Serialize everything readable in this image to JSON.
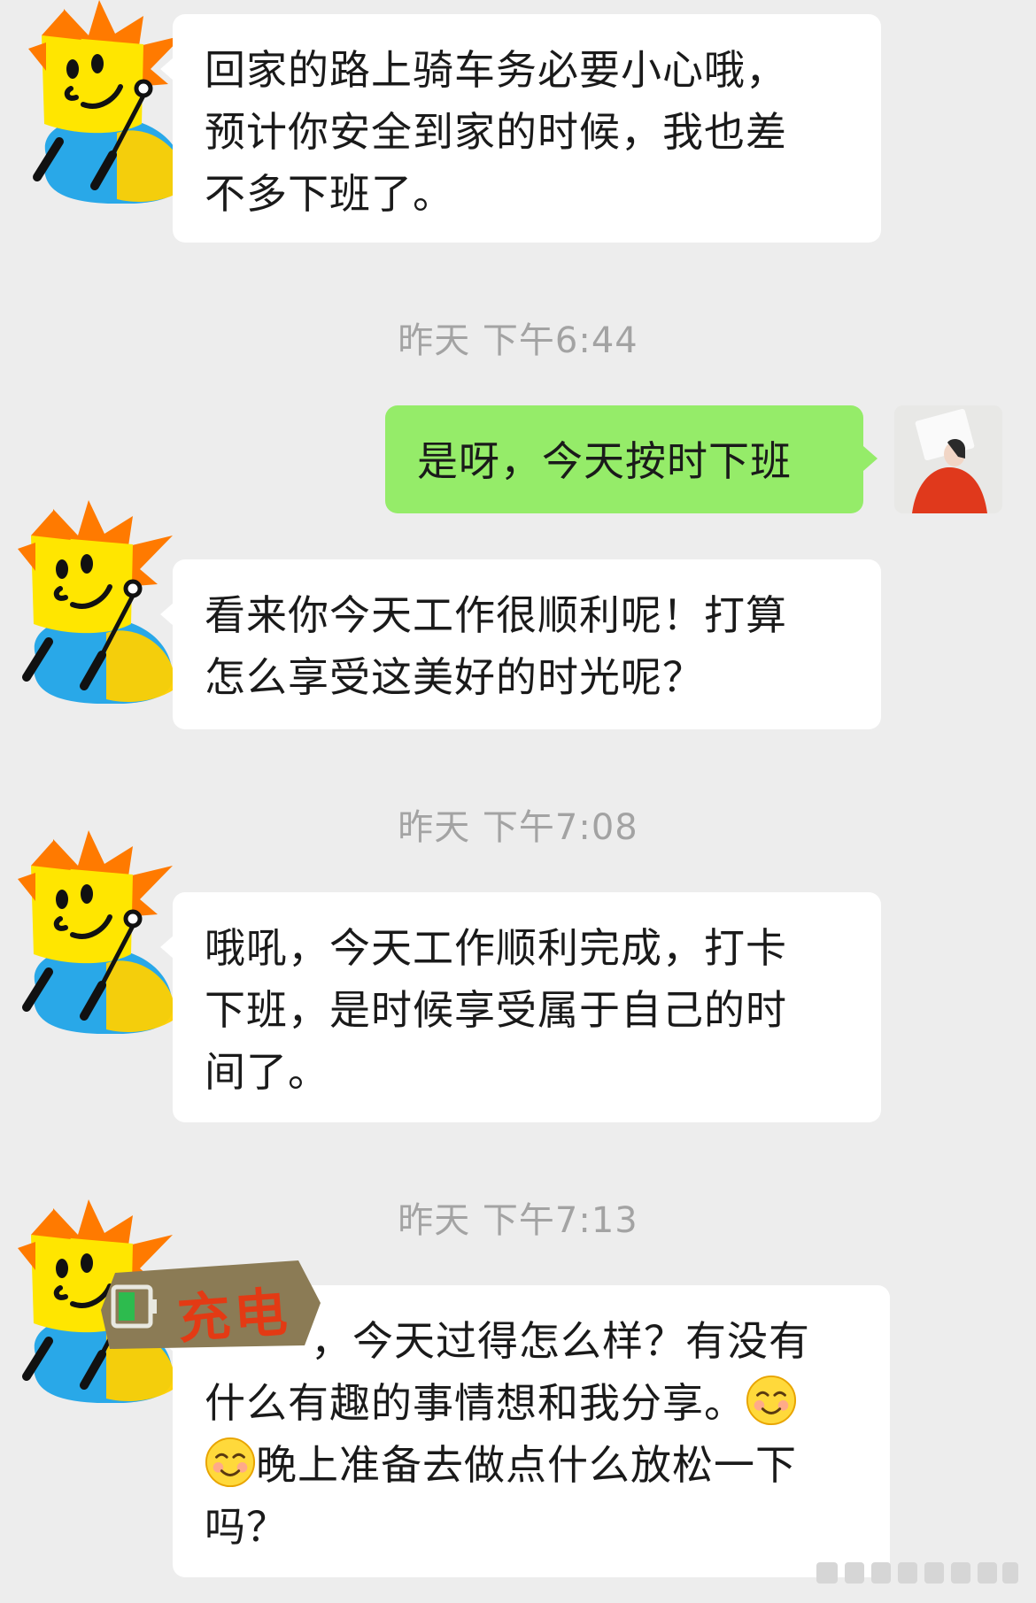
{
  "messages": [
    {
      "id": "m1",
      "sender": "bot",
      "text": "回家的路上骑车务必要小心哦，\n预计你安全到家的时候，我也差\n不多下班了。"
    },
    {
      "id": "m2",
      "sender": "user",
      "text": "是呀，今天按时下班"
    },
    {
      "id": "m3",
      "sender": "bot",
      "text": "看来你今天工作很顺利呢！打算\n怎么享受这美好的时光呢？"
    },
    {
      "id": "m4",
      "sender": "bot",
      "text": "哦吼，今天工作顺利完成，打卡\n下班，是时候享受属于自己的时\n间了。"
    },
    {
      "id": "m5",
      "sender": "bot",
      "text_line1": "，今天过得怎么样？有没有",
      "text_line2": "什么有趣的事情想和我分享。",
      "text_line3": "晚上准备去做点什么放松一下",
      "text_line4": "吗？"
    }
  ],
  "timestamps": {
    "t1": "昨天 下午6:44",
    "t2": "昨天 下午7:08",
    "t3": "昨天 下午7:13"
  },
  "sticker": {
    "text": "充电",
    "icon": "battery-icon"
  },
  "icons": {
    "bot_avatar": "cartoon-robot-avatar-icon",
    "user_avatar": "user-photo-avatar",
    "emoji": "smiling-face-emoji-icon"
  },
  "colors": {
    "background": "#ededed",
    "bubble_in": "#ffffff",
    "bubble_out": "#95ec69",
    "timestamp": "#a3a3a3"
  }
}
